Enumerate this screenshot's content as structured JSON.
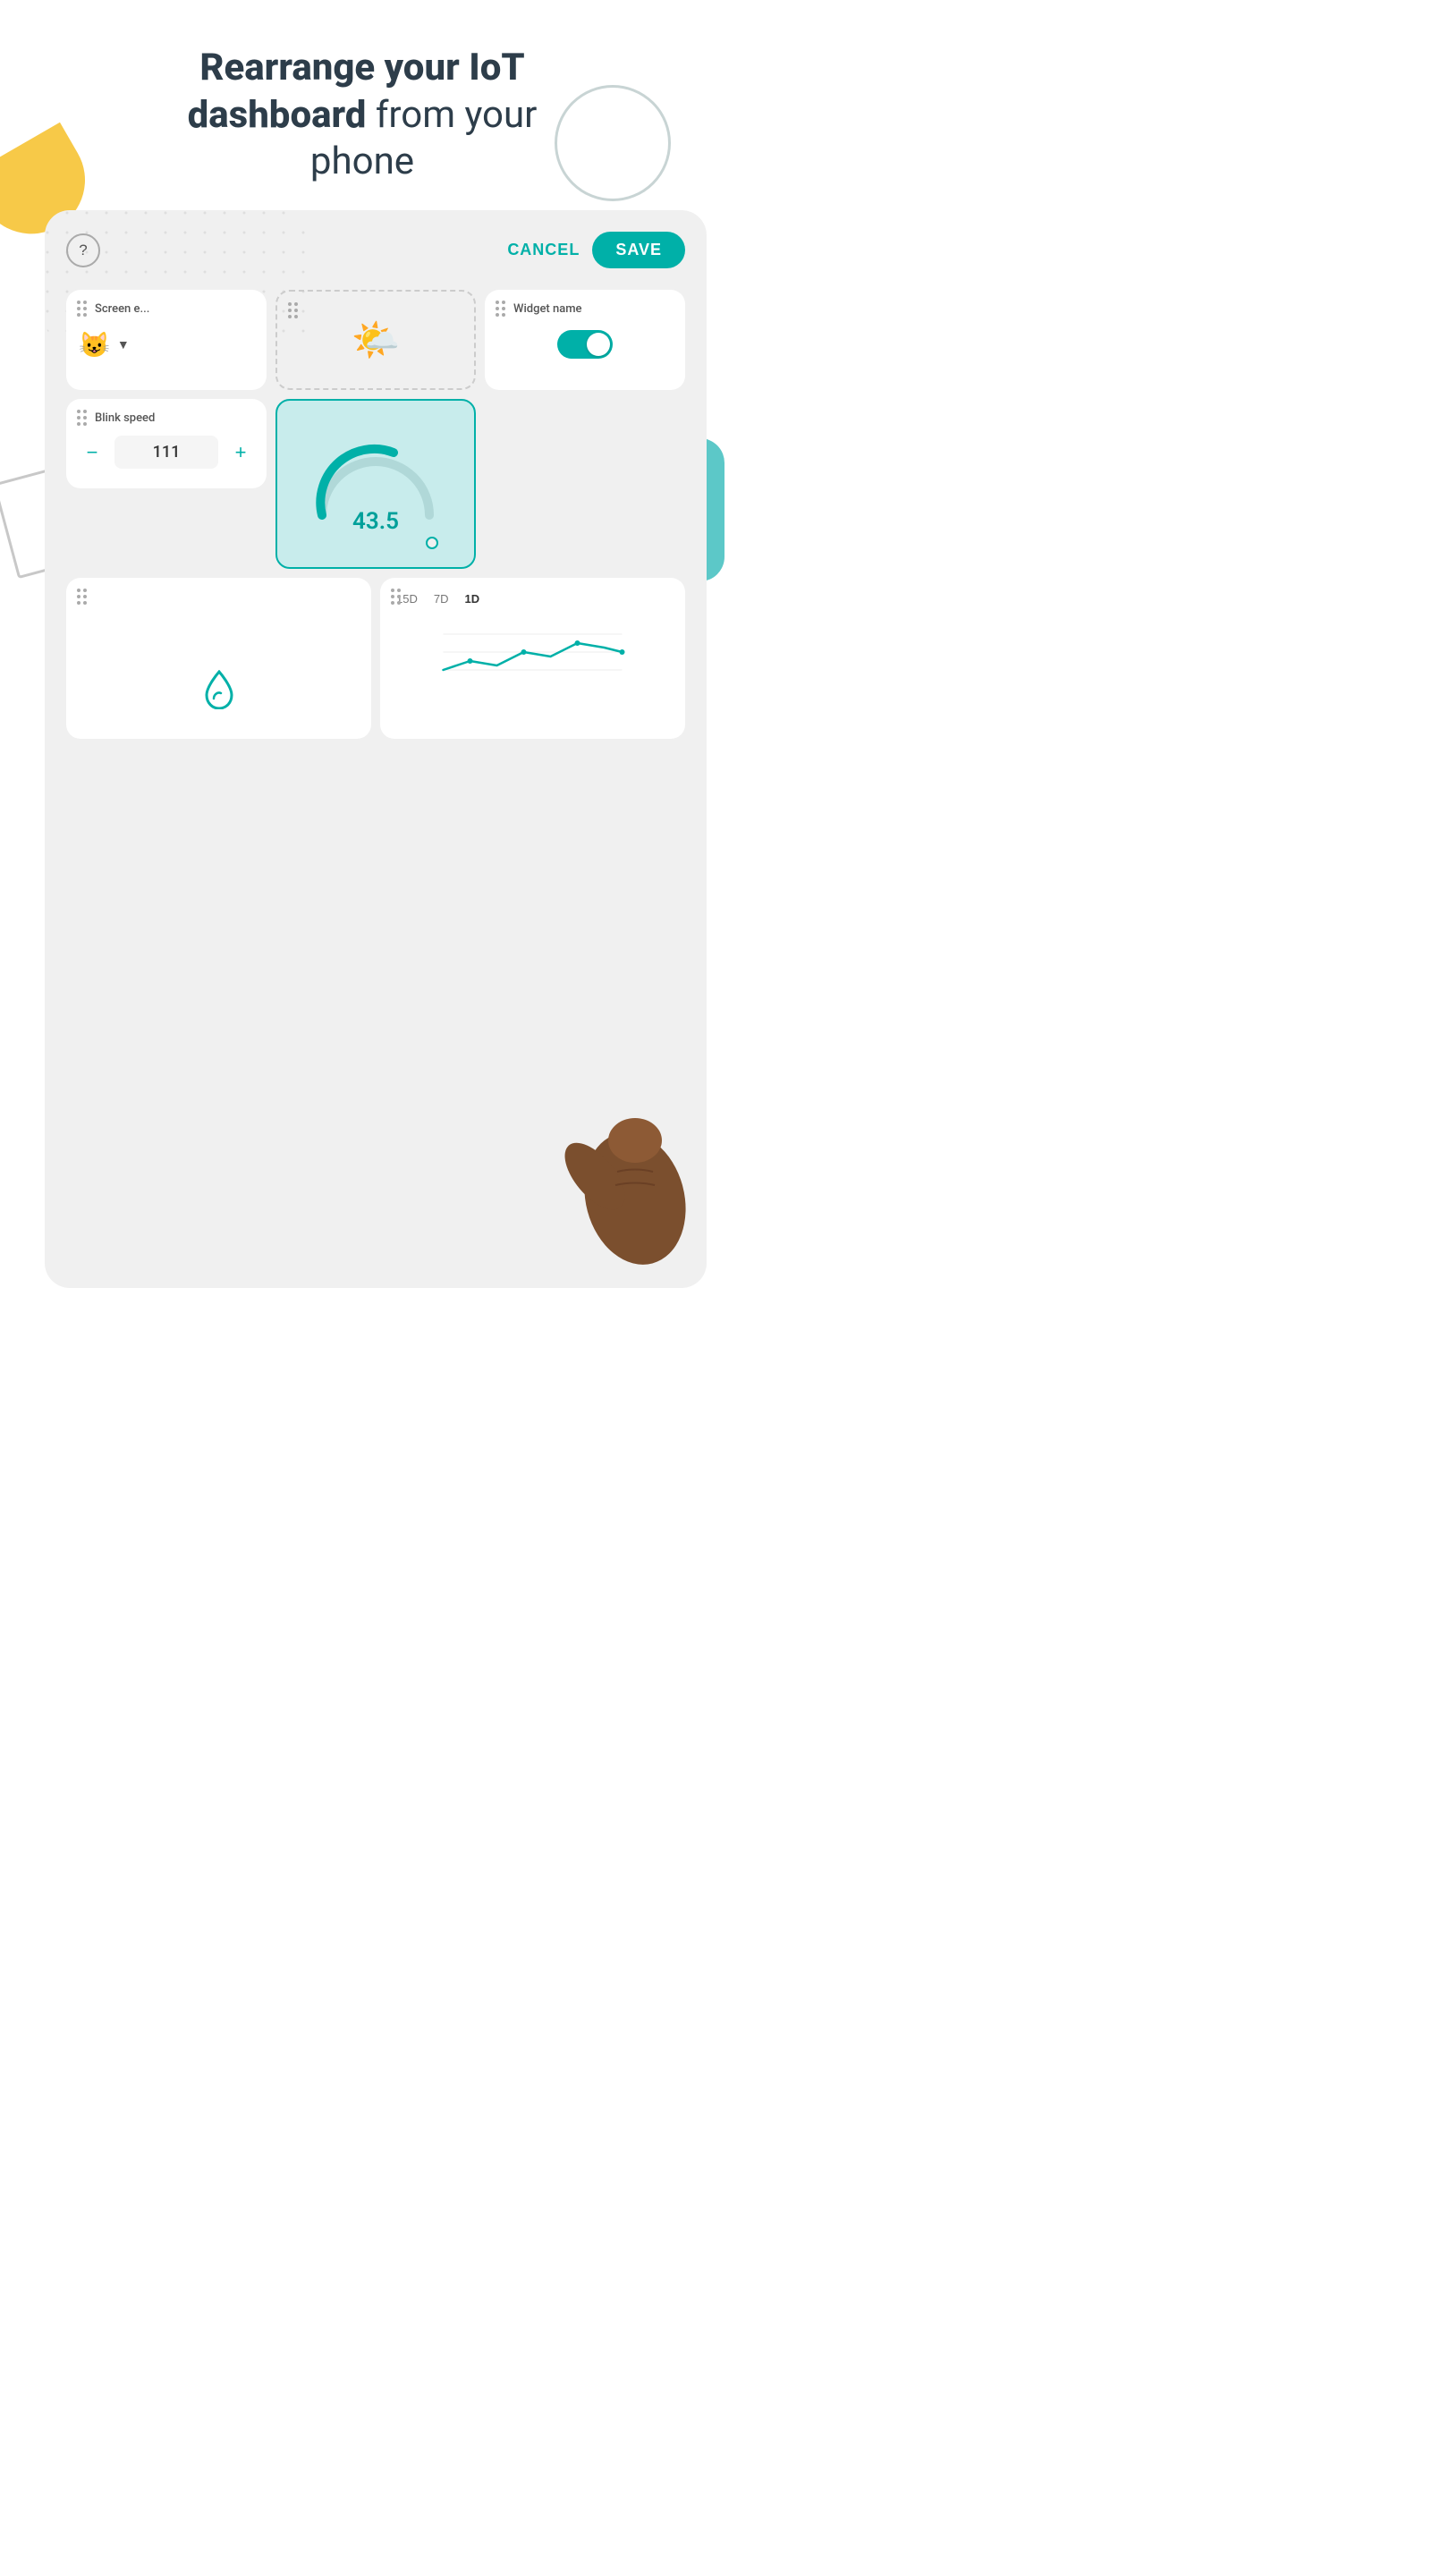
{
  "header": {
    "line1": "Rearrange your IoT",
    "line1_bold": "Rearrange your IoT",
    "line2_bold": "dashboard",
    "line2_rest": " from your",
    "line3": "phone"
  },
  "toolbar": {
    "cancel_label": "CANCEL",
    "save_label": "SAVE",
    "help_icon": "?"
  },
  "widgets": {
    "screen_emoji": {
      "label": "Screen e...",
      "emoji": "😺",
      "has_dropdown": true
    },
    "sun": {
      "label": "",
      "icon": "☀️"
    },
    "widget_name": {
      "label": "Widget name",
      "toggle_on": true
    },
    "blink_speed": {
      "label": "Blink speed",
      "value": "111",
      "minus": "−",
      "plus": "+"
    },
    "gauge": {
      "value": "43.5"
    }
  },
  "bottom_bar": {
    "time_filters": [
      "15D",
      "7D",
      "1D"
    ]
  },
  "colors": {
    "teal": "#00b0a8",
    "yellow": "#f7c948",
    "light_teal_bg": "#d4f0f0",
    "grey_bg": "#f0f0f0"
  }
}
